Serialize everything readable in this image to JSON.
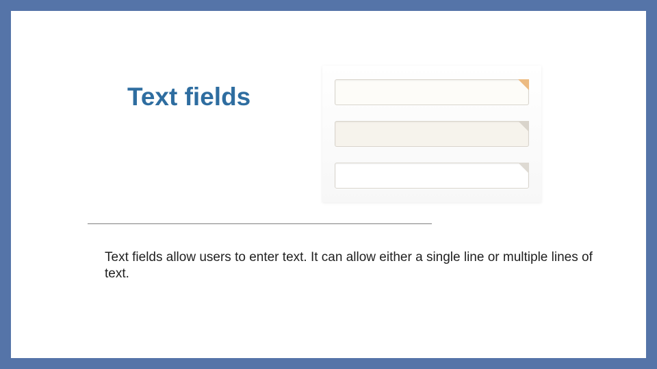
{
  "slide": {
    "heading": "Text fields",
    "body": "Text fields allow users to enter text.  It can allow either a single line or multiple lines of text."
  },
  "illustration": {
    "fields": [
      {
        "variant": "variant1",
        "corner": "corner1"
      },
      {
        "variant": "variant2",
        "corner": "corner2"
      },
      {
        "variant": "variant3",
        "corner": "corner3"
      }
    ]
  },
  "colors": {
    "frame": "#5574a8",
    "heading": "#2e6da0"
  }
}
